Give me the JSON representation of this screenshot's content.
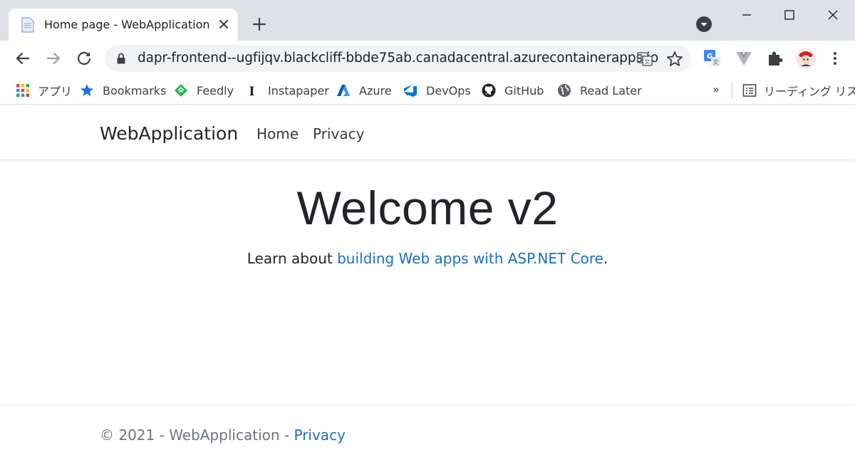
{
  "browser": {
    "tab": {
      "title": "Home page - WebApplication"
    },
    "address_bar": {
      "url": "dapr-frontend--ugfijqv.blackcliff-bbde75ab.canadacentral.azurecontainerapps.io"
    },
    "bookmarks": [
      {
        "label": "アプリ",
        "icon": "apps-grid-icon"
      },
      {
        "label": "Bookmarks",
        "icon": "star-icon"
      },
      {
        "label": "Feedly",
        "icon": "feedly-icon"
      },
      {
        "label": "Instapaper",
        "icon": "instapaper-icon"
      },
      {
        "label": "Azure",
        "icon": "azure-icon"
      },
      {
        "label": "DevOps",
        "icon": "devops-icon"
      },
      {
        "label": "GitHub",
        "icon": "github-icon"
      },
      {
        "label": "Read Later",
        "icon": "globe-icon"
      }
    ],
    "bookmarks_overflow": "»",
    "reading_list": {
      "label": "リーディング リスト"
    },
    "colors": {
      "tabstrip": "#dee1e6",
      "omnibox": "#f1f3f4"
    }
  },
  "site": {
    "brand": "WebApplication",
    "nav": [
      {
        "label": "Home"
      },
      {
        "label": "Privacy"
      }
    ],
    "heading": "Welcome v2",
    "learn": {
      "prefix": "Learn about ",
      "link_text": "building Web apps with ASP.NET Core",
      "suffix": "."
    },
    "footer": {
      "copyright": "© 2021 - WebApplication - ",
      "link_text": "Privacy"
    },
    "colors": {
      "link": "#1b6ec2",
      "text": "#212529",
      "footer_text": "#6c757d"
    }
  }
}
